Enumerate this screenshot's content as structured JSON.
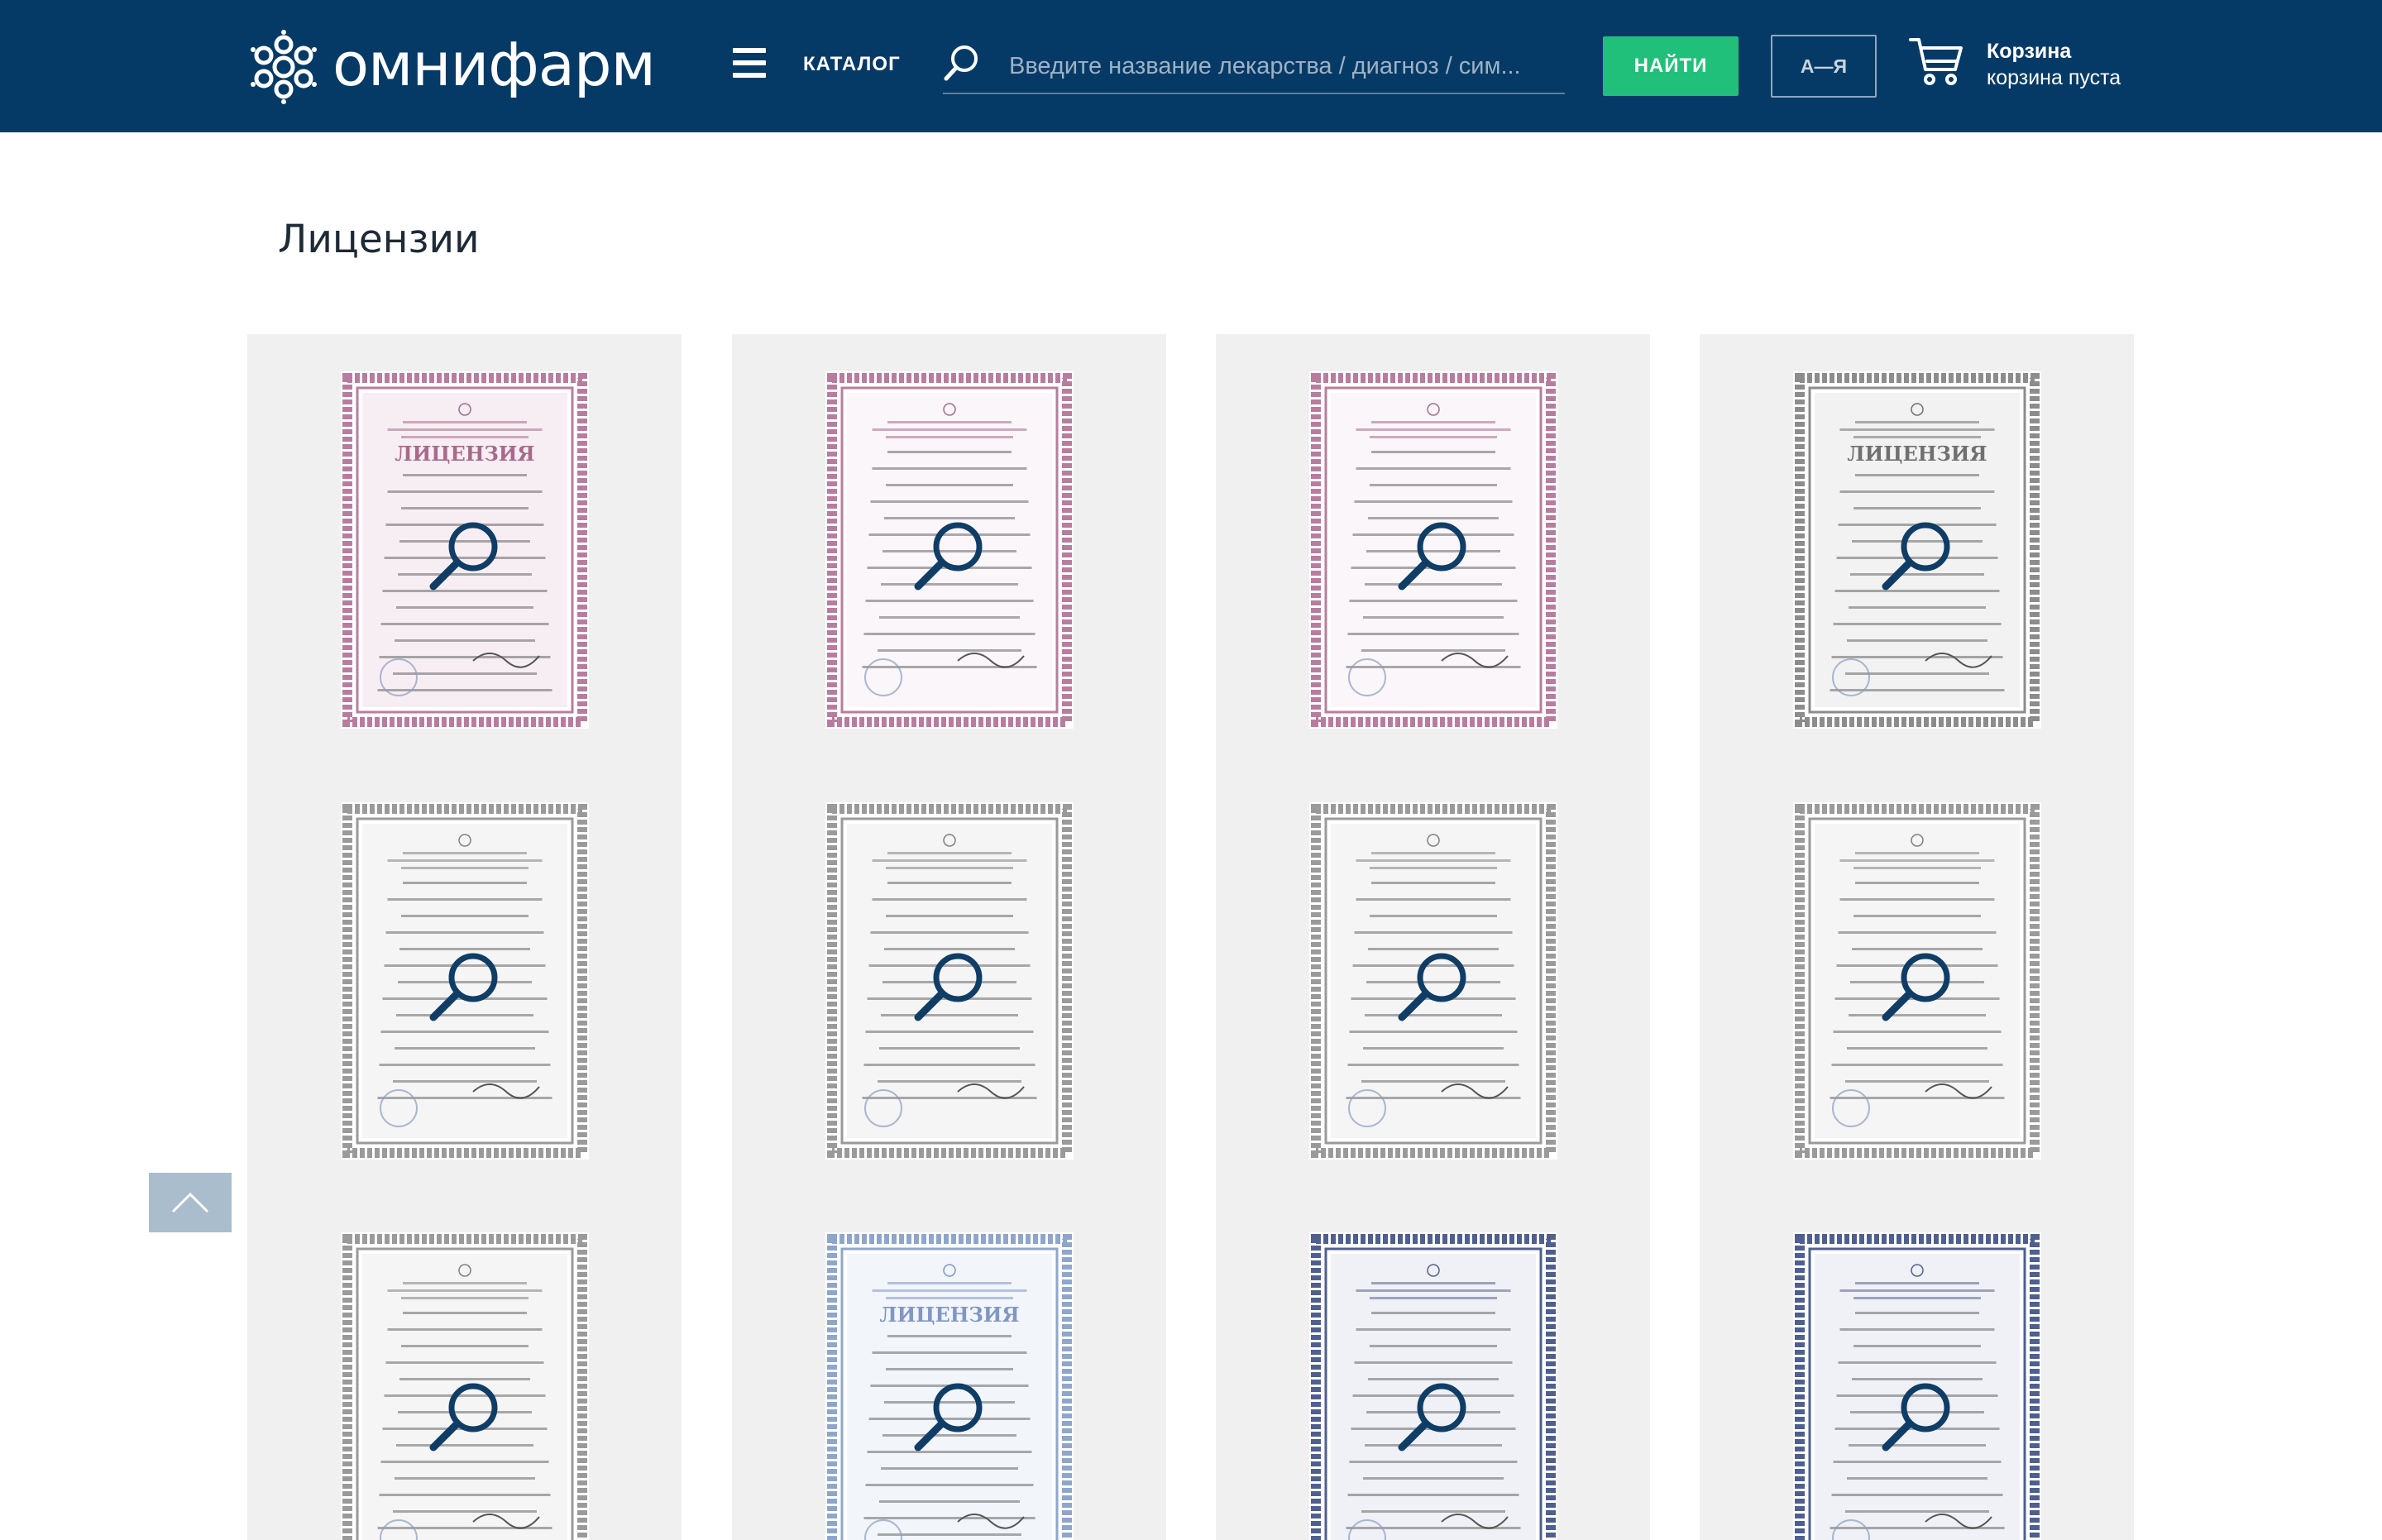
{
  "header": {
    "brand": "омнифарм",
    "catalog_label": "КАТАЛОГ",
    "search_placeholder": "Введите название лекарства / диагноз / сим...",
    "find_label": "НАЙТИ",
    "az_label": "А—Я",
    "cart_title": "Корзина",
    "cart_status": "корзина пуста"
  },
  "page": {
    "title": "Лицензии"
  },
  "documents": [
    {
      "style": "pink-license",
      "heading": "ЛИЦЕНЗИЯ"
    },
    {
      "style": "pink-plain",
      "heading": ""
    },
    {
      "style": "pink-plain",
      "heading": ""
    },
    {
      "style": "gray-license",
      "heading": "ЛИЦЕНЗИЯ"
    },
    {
      "style": "gray-plain",
      "heading": ""
    },
    {
      "style": "gray-plain",
      "heading": ""
    },
    {
      "style": "gray-plain",
      "heading": ""
    },
    {
      "style": "gray-plain",
      "heading": ""
    },
    {
      "style": "gray-plain",
      "heading": ""
    },
    {
      "style": "blue-license",
      "heading": "ЛИЦЕНЗИЯ"
    },
    {
      "style": "navy-plain",
      "heading": ""
    },
    {
      "style": "navy-plain",
      "heading": ""
    }
  ],
  "colors": {
    "header_bg": "#063a66",
    "find_button": "#21c07a",
    "pink_border": "#b87d9e",
    "gray_border": "#8c8c8c",
    "blue_border": "#8fa6cc",
    "navy_border": "#4f5f8f",
    "zoom_icon": "#0f3d66"
  },
  "icons": [
    "logo-icon",
    "menu-icon",
    "search-icon",
    "cart-icon",
    "zoom-icon",
    "arrow-up-icon"
  ]
}
